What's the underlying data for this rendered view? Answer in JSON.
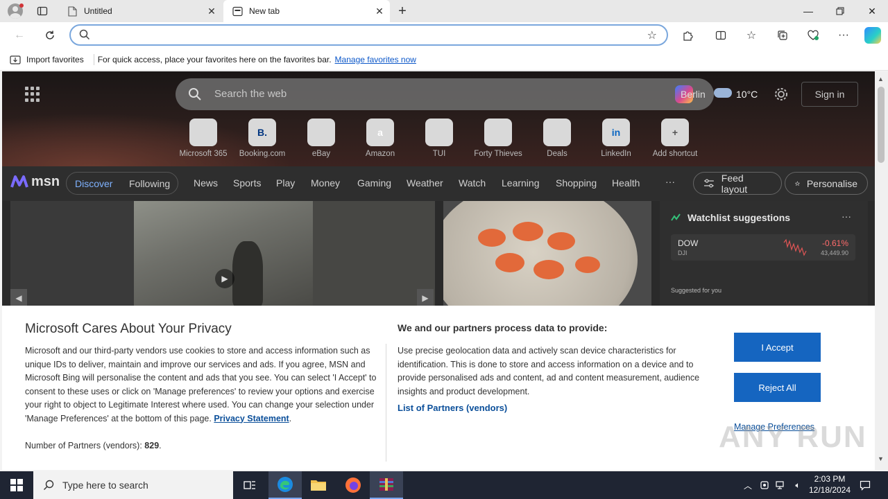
{
  "browser": {
    "tabs": [
      {
        "label": "Untitled",
        "icon": "page-icon"
      },
      {
        "label": "New tab",
        "icon": "newtab-icon",
        "active": true
      }
    ],
    "address": {
      "placeholder": "",
      "value": ""
    },
    "favorites_bar": {
      "import_label": "Import favorites",
      "hint": "For quick access, place your favorites here on the favorites bar.",
      "manage_link": "Manage favorites now"
    }
  },
  "newtab": {
    "search_placeholder": "Search the web",
    "weather": {
      "city": "Berlin",
      "temp": "10°C"
    },
    "sign_in": "Sign in",
    "shortcuts": [
      {
        "label": "Microsoft 365",
        "glyph": "",
        "color": "#c5b8e8"
      },
      {
        "label": "Booking.com",
        "glyph": "B.",
        "color": "#003580"
      },
      {
        "label": "eBay",
        "glyph": "",
        "color": "#e8e8e8"
      },
      {
        "label": "Amazon",
        "glyph": "a",
        "color": "#ffffff"
      },
      {
        "label": "TUI",
        "glyph": "",
        "color": "#a9d7f0"
      },
      {
        "label": "Forty Thieves",
        "glyph": "",
        "color": "#ffffff"
      },
      {
        "label": "Deals",
        "glyph": "",
        "color": "#e07b39"
      },
      {
        "label": "LinkedIn",
        "glyph": "in",
        "color": "#0a66c2"
      },
      {
        "label": "Add shortcut",
        "glyph": "+",
        "color": "#555555"
      }
    ],
    "msn": {
      "logo": "msn",
      "pill_discover": "Discover",
      "pill_following": "Following",
      "nav": [
        "News",
        "Sports",
        "Play",
        "Money",
        "Gaming",
        "Weather",
        "Watch",
        "Learning",
        "Shopping",
        "Health"
      ],
      "more": "···",
      "feed_layout": "Feed layout",
      "personalise": "Personalise"
    },
    "watchlist": {
      "title": "Watchlist suggestions",
      "more": "···",
      "row": {
        "symbol": "DOW",
        "sub": "DJI",
        "change": "-0.61%",
        "value": "43,449.90"
      },
      "suggested": "Suggested for you"
    }
  },
  "privacy": {
    "title": "Microsoft Cares About Your Privacy",
    "body": "Microsoft and our third-party vendors use cookies to store and access information such as unique IDs to deliver, maintain and improve our services and ads. If you agree, MSN and Microsoft Bing will personalise the content and ads that you see. You can select 'I Accept' to consent to these uses or click on 'Manage preferences' to review your options and exercise your right to object to Legitimate Interest where used.  You can change your selection under 'Manage Preferences' at the bottom of this page.",
    "privacy_link": "Privacy Statement",
    "partners_label": "Number of Partners (vendors):",
    "partners_count": "829",
    "sub_title": "We and our partners process data to provide:",
    "body2": "Use precise geolocation data and actively scan device characteristics for identification. This is done to store and access information on a device and to provide personalised ads and content, ad and content measurement, audience insights and product development.",
    "list_link": "List of Partners (vendors)",
    "accept": "I Accept",
    "reject": "Reject All",
    "manage": "Manage Preferences"
  },
  "watermark": "ANY RUN",
  "taskbar": {
    "search_placeholder": "Type here to search",
    "time": "2:03 PM",
    "date": "12/18/2024"
  }
}
